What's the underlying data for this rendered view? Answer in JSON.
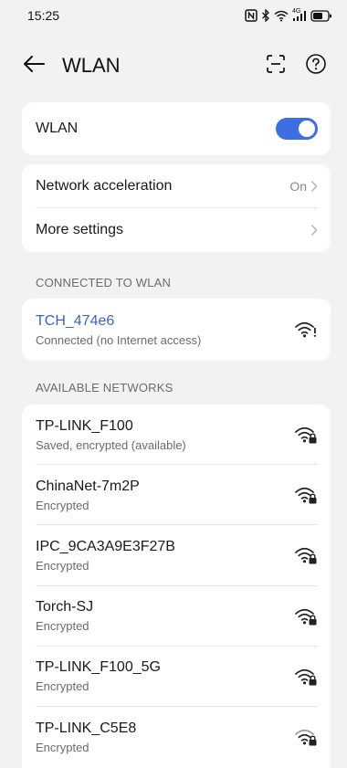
{
  "status_bar": {
    "time": "15:25",
    "icons": [
      "nfc-icon",
      "bluetooth-icon",
      "wifi-status-icon",
      "signal-4g-icon",
      "battery-icon"
    ],
    "network_type": "4G"
  },
  "app_bar": {
    "title": "WLAN",
    "back_icon": "arrow-left-icon",
    "scan_icon": "scan-icon",
    "help_icon": "help-icon"
  },
  "wlan_toggle": {
    "label": "WLAN",
    "state": "on"
  },
  "settings": {
    "network_acceleration": {
      "label": "Network acceleration",
      "value": "On"
    },
    "more_settings": {
      "label": "More settings"
    }
  },
  "connected": {
    "header": "CONNECTED TO WLAN",
    "network": {
      "name": "TCH_474e6",
      "status": "Connected (no Internet access)",
      "icon": "wifi-no-internet-icon"
    }
  },
  "available": {
    "header": "AVAILABLE NETWORKS",
    "networks": [
      {
        "name": "TP-LINK_F100",
        "status": "Saved, encrypted (available)",
        "icon": "wifi-lock-icon"
      },
      {
        "name": "ChinaNet-7m2P",
        "status": "Encrypted",
        "icon": "wifi-lock-icon"
      },
      {
        "name": "IPC_9CA3A9E3F27B",
        "status": "Encrypted",
        "icon": "wifi-lock-icon"
      },
      {
        "name": "Torch-SJ",
        "status": "Encrypted",
        "icon": "wifi-lock-icon"
      },
      {
        "name": "TP-LINK_F100_5G",
        "status": "Encrypted",
        "icon": "wifi-lock-icon"
      },
      {
        "name": "TP-LINK_C5E8",
        "status": "Encrypted",
        "icon": "wifi-lock-icon"
      }
    ]
  },
  "colors": {
    "accent": "#3d6fe0",
    "connected_text": "#3a63c8",
    "background": "#f2f2f2",
    "card": "#ffffff"
  }
}
